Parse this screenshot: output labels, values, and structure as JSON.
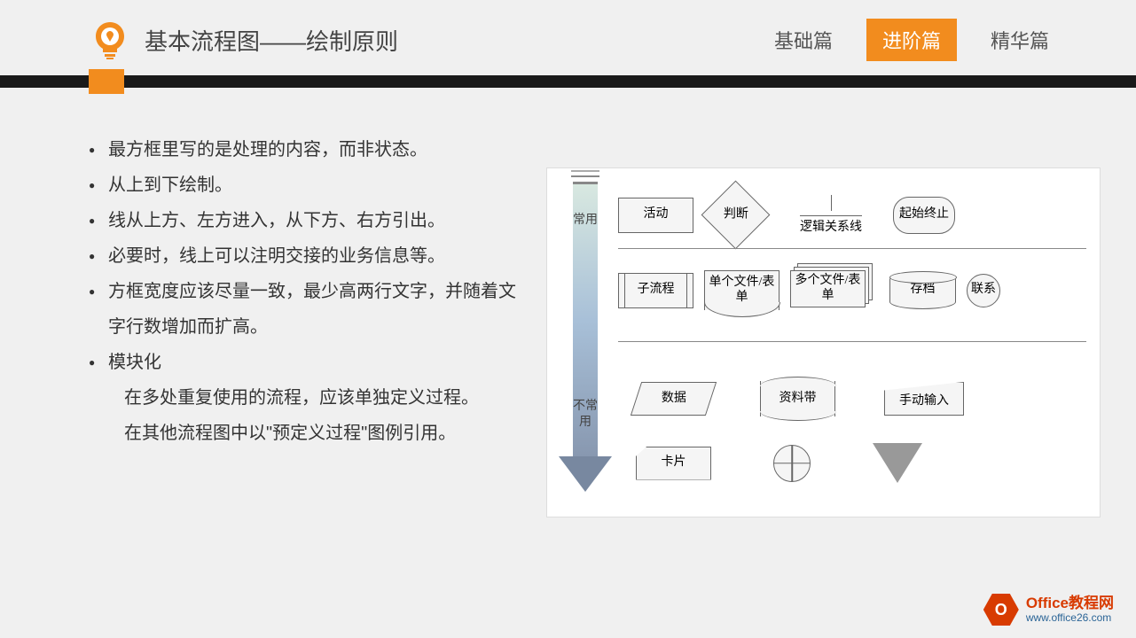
{
  "header": {
    "title": "基本流程图——绘制原则",
    "tabs": [
      "基础篇",
      "进阶篇",
      "精华篇"
    ],
    "active_tab": 1
  },
  "bullets": [
    "最方框里写的是处理的内容，而非状态。",
    "从上到下绘制。",
    "线从上方、左方进入，从下方、右方引出。",
    "必要时，线上可以注明交接的业务信息等。",
    "方框宽度应该尽量一致，最少高两行文字，并随着文字行数增加而扩高。",
    "模块化"
  ],
  "sub_bullets": [
    "在多处重复使用的流程，应该单独定义过程。",
    "在其他流程图中以\"预定义过程\"图例引用。"
  ],
  "diagram": {
    "arrow_label_top": "常用",
    "arrow_label_bottom": "不常用",
    "row1": {
      "activity": "活动",
      "decision": "判断",
      "logic": "逻辑关系线",
      "terminator": "起始终止"
    },
    "row2": {
      "subprocess": "子流程",
      "single_doc": "单个文件/表单",
      "multi_doc": "多个文件/表单",
      "storage": "存档",
      "connector": "联系"
    },
    "row3": {
      "data": "数据",
      "tape": "资料带",
      "manual": "手动输入"
    },
    "row4": {
      "card": "卡片"
    }
  },
  "footer": {
    "logo_letter": "O",
    "title": "Office教程网",
    "url": "www.office26.com"
  }
}
